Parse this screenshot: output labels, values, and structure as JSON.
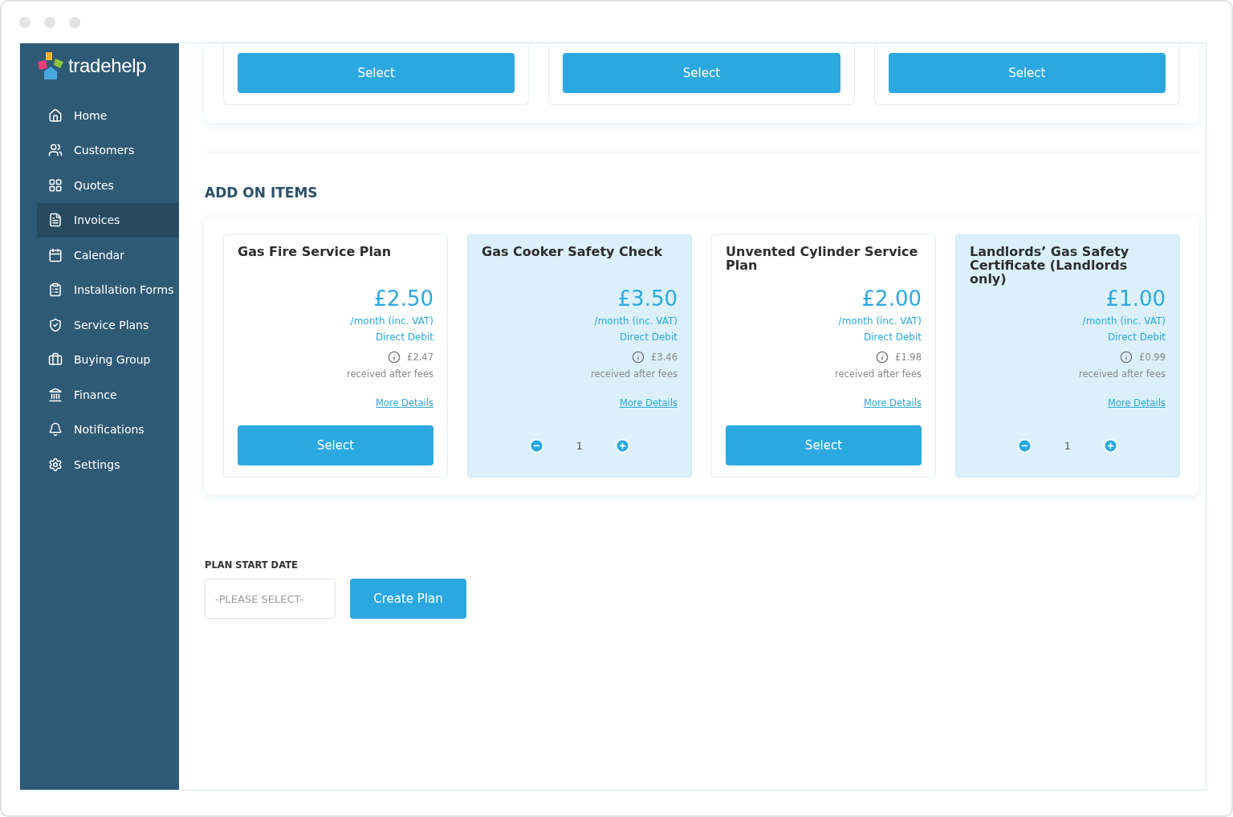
{
  "sidebar": {
    "logo": "trade**help**",
    "items": [
      {
        "label": "Home",
        "selected": false
      },
      {
        "label": "Customers",
        "selected": false
      },
      {
        "label": "Quotes",
        "selected": false
      },
      {
        "label": "Invoices",
        "selected": true
      },
      {
        "label": "Calendar",
        "selected": false
      },
      {
        "label": "Installation Forms",
        "selected": false
      },
      {
        "label": "Service Plans",
        "selected": false
      },
      {
        "label": "Buying Group",
        "selected": false
      },
      {
        "label": "Finance",
        "selected": false
      },
      {
        "label": "Notifications",
        "selected": false
      },
      {
        "label": "Settings",
        "selected": false
      }
    ]
  },
  "plans": [
    {
      "button": "Select"
    },
    {
      "button": "Select"
    },
    {
      "button": "Select"
    }
  ],
  "add_on_items": {
    "heading": "ADD ON ITEMS",
    "items": [
      {
        "title": "Gas Fire Service Plan",
        "price": "£2.50",
        "period": "/month (inc. VAT)",
        "method": "Direct Debit",
        "net": "£2.47",
        "net_note": "received after fees",
        "link": "More Details",
        "selected": false,
        "button": "Select"
      },
      {
        "title": "Gas Cooker Safety Check",
        "price": "£3.50",
        "period": "/month (inc. VAT)",
        "method": "Direct Debit",
        "net": "£3.46",
        "net_note": "received after fees",
        "link": "More Details",
        "selected": true,
        "quantity": "1"
      },
      {
        "title": "Unvented Cylinder Service Plan",
        "price": "£2.00",
        "period": "/month (inc. VAT)",
        "method": "Direct Debit",
        "net": "£1.98",
        "net_note": "received after fees",
        "link": "More Details",
        "selected": false,
        "button": "Select"
      },
      {
        "title": "Landlords’ Gas Safety Certificate (Landlords only)",
        "price": "£1.00",
        "period": "/month (inc. VAT)",
        "method": "Direct Debit",
        "net": "£0.99",
        "net_note": "received after fees",
        "link": "More Details",
        "selected": true,
        "quantity": "1"
      }
    ]
  },
  "plan_start_date": {
    "label": "PLAN START DATE",
    "placeholder": "-PLEASE SELECT-",
    "button": "Create Plan"
  }
}
